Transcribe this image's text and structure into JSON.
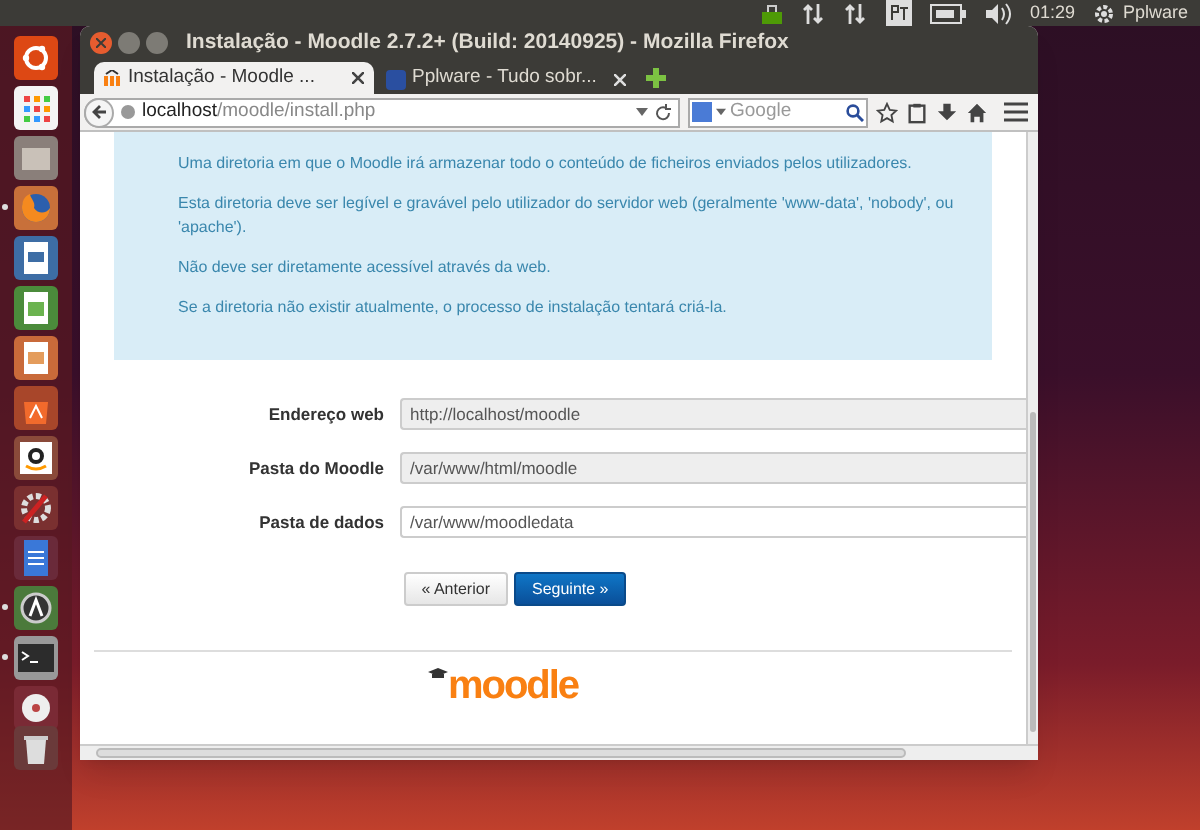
{
  "top_panel": {
    "clock": "01:29",
    "user": "Pplware"
  },
  "launcher": [
    {
      "kind": "ubuntu",
      "running": false
    },
    {
      "kind": "apps",
      "running": false
    },
    {
      "kind": "files",
      "running": false
    },
    {
      "kind": "firefox",
      "running": true
    },
    {
      "kind": "writer",
      "running": false
    },
    {
      "kind": "calc",
      "running": false
    },
    {
      "kind": "impress",
      "running": false
    },
    {
      "kind": "software",
      "running": false
    },
    {
      "kind": "amazon",
      "running": false
    },
    {
      "kind": "settings",
      "running": false
    },
    {
      "kind": "docs",
      "running": false
    },
    {
      "kind": "updater",
      "running": true
    },
    {
      "kind": "terminal",
      "running": true
    },
    {
      "kind": "disc",
      "running": false
    },
    {
      "kind": "trash",
      "running": false
    }
  ],
  "window": {
    "title": "Instalação - Moodle 2.7.2+ (Build: 20140925) - Mozilla Firefox",
    "tabs": [
      {
        "label": "Instalação - Moodle ...",
        "selected": true
      },
      {
        "label": "Pplware - Tudo sobr...",
        "selected": false
      }
    ],
    "url": {
      "host": "localhost",
      "path": "/moodle/install.php"
    },
    "search": {
      "placeholder": "Google"
    }
  },
  "page": {
    "info": [
      "Uma diretoria em que o Moodle irá armazenar todo o conteúdo de ficheiros enviados pelos utilizadores.",
      "Esta diretoria deve ser legível e gravável pelo utilizador do servidor web (geralmente 'www-data', 'nobody', ou 'apache').",
      "Não deve ser diretamente acessível através da web.",
      "Se a diretoria não existir atualmente, o processo de instalação tentará criá-la."
    ],
    "fields": [
      {
        "label": "Endereço web",
        "value": "http://localhost/moodle",
        "disabled": true
      },
      {
        "label": "Pasta do Moodle",
        "value": "/var/www/html/moodle",
        "disabled": true
      },
      {
        "label": "Pasta de dados",
        "value": "/var/www/moodledata",
        "disabled": false
      }
    ],
    "buttons": [
      {
        "label": "« Anterior",
        "primary": false
      },
      {
        "label": "Seguinte »",
        "primary": true
      }
    ],
    "logo": "moodle"
  }
}
